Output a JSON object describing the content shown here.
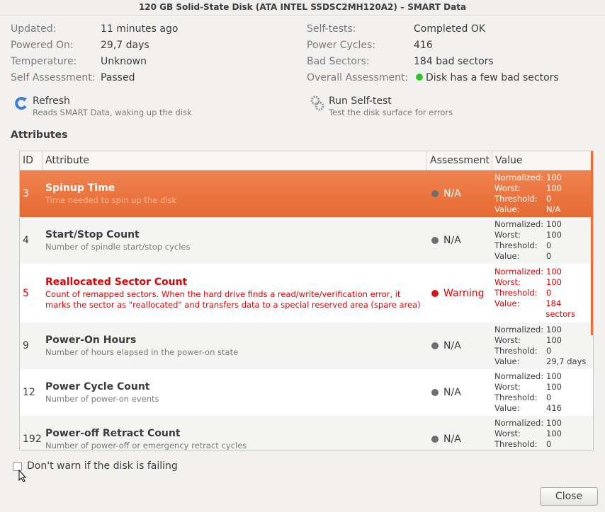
{
  "window": {
    "title": "120 GB Solid-State Disk (ATA INTEL SSDSC2MH120A2) – SMART Data"
  },
  "info_left": [
    {
      "label": "Updated:",
      "value": "11 minutes ago"
    },
    {
      "label": "Powered On:",
      "value": "29,7 days"
    },
    {
      "label": "Temperature:",
      "value": "Unknown"
    },
    {
      "label": "Self Assessment:",
      "value": "Passed"
    }
  ],
  "info_right": [
    {
      "label": "Self-tests:",
      "value": "Completed OK"
    },
    {
      "label": "Power Cycles:",
      "value": "416"
    },
    {
      "label": "Bad Sectors:",
      "value": "184 bad sectors"
    },
    {
      "label": "Overall Assessment:",
      "value": "Disk has a few bad sectors",
      "status_color": "#2ec52e"
    }
  ],
  "actions": {
    "refresh": {
      "title": "Refresh",
      "subtitle": "Reads SMART Data, waking up the disk",
      "icon": "refresh-icon"
    },
    "selftest": {
      "title": "Run Self-test",
      "subtitle": "Test the disk surface for errors",
      "icon": "gears-icon"
    }
  },
  "attributes_heading": "Attributes",
  "table": {
    "headers": [
      "ID",
      "Attribute",
      "Assessment",
      "Value"
    ],
    "value_labels": [
      "Normalized:",
      "Worst:",
      "Threshold:",
      "Value:"
    ],
    "rows": [
      {
        "id": "3",
        "name": "Spinup Time",
        "desc": "Time needed to spin up the disk",
        "assessment": "N/A",
        "normalized": "100",
        "worst": "100",
        "threshold": "0",
        "value": "N/A",
        "selected": true
      },
      {
        "id": "4",
        "name": "Start/Stop Count",
        "desc": "Number of spindle start/stop cycles",
        "assessment": "N/A",
        "normalized": "100",
        "worst": "100",
        "threshold": "0",
        "value": "0"
      },
      {
        "id": "5",
        "name": "Reallocated Sector Count",
        "desc": "Count of remapped sectors. When the hard drive finds a read/write/verification error, it marks the sector as \"reallocated\" and transfers data to a special reserved area (spare area)",
        "assessment": "Warning",
        "normalized": "100",
        "worst": "100",
        "threshold": "0",
        "value": "184 sectors",
        "warning": true
      },
      {
        "id": "9",
        "name": "Power-On Hours",
        "desc": "Number of hours elapsed in the power-on state",
        "assessment": "N/A",
        "normalized": "100",
        "worst": "100",
        "threshold": "0",
        "value": "29,7 days"
      },
      {
        "id": "12",
        "name": "Power Cycle Count",
        "desc": "Number of power-on events",
        "assessment": "N/A",
        "normalized": "100",
        "worst": "100",
        "threshold": "0",
        "value": "416"
      },
      {
        "id": "192",
        "name": "Power-off Retract Count",
        "desc": "Number of power-off or emergency retract cycles",
        "assessment": "N/A",
        "normalized": "100",
        "worst": "100",
        "threshold": "0",
        "value": ""
      }
    ]
  },
  "checkbox": {
    "label": "Don't warn if the disk is failing",
    "checked": false
  },
  "close_button": "Close",
  "colors": {
    "selected_row": "#e9743e",
    "warning": "#e00000",
    "ok": "#2ec52e",
    "na": "#6e6e6e"
  }
}
